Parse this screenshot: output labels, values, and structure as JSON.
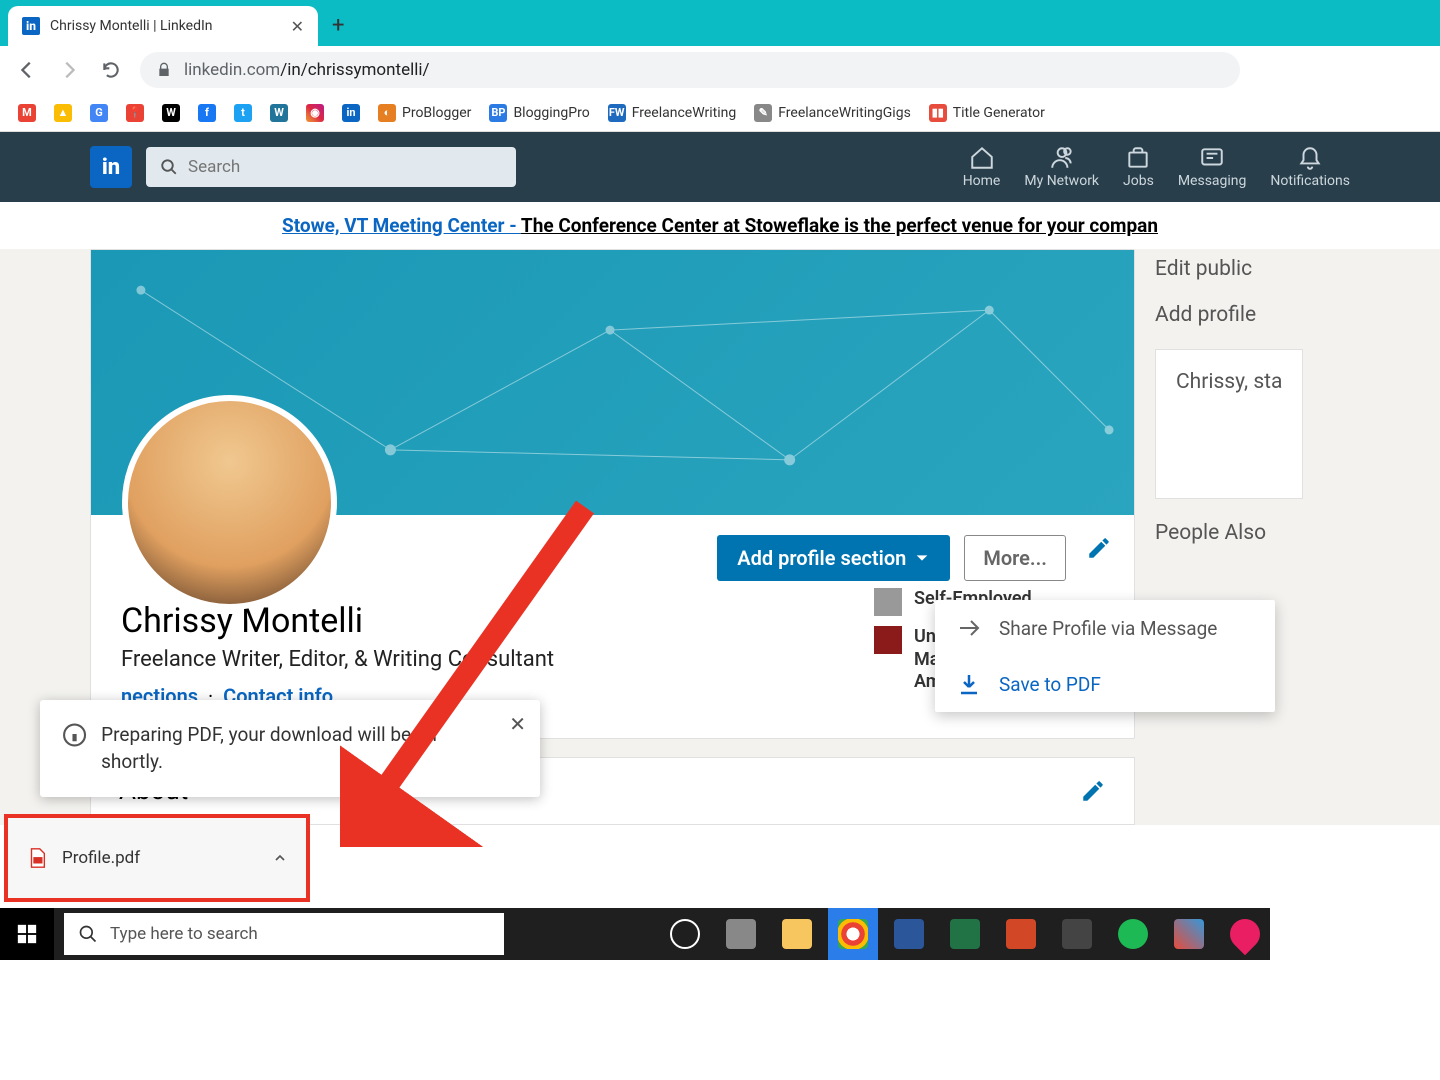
{
  "browser": {
    "tab_title": "Chrissy Montelli | LinkedIn",
    "url_host": "linkedin.com",
    "url_path": "/in/chrissymontelli/"
  },
  "bookmarks": [
    {
      "label": "",
      "icon": "M",
      "bg": "#ea4335"
    },
    {
      "label": "",
      "icon": "▲",
      "bg": "#fbbc04"
    },
    {
      "label": "",
      "icon": "G",
      "bg": "#4285f4"
    },
    {
      "label": "",
      "icon": "📍",
      "bg": "#ea4335"
    },
    {
      "label": "",
      "icon": "W",
      "bg": "#000"
    },
    {
      "label": "",
      "icon": "f",
      "bg": "#1877f2"
    },
    {
      "label": "",
      "icon": "t",
      "bg": "#1da1f2"
    },
    {
      "label": "",
      "icon": "W",
      "bg": "#21759b"
    },
    {
      "label": "",
      "icon": "◉",
      "bg": "linear-gradient(45deg,#f09433,#e6683c,#dc2743,#cc2366,#bc1888)"
    },
    {
      "label": "",
      "icon": "in",
      "bg": "#0a66c2"
    },
    {
      "label": "ProBlogger",
      "icon": "◐",
      "bg": "#e67e22"
    },
    {
      "label": "BloggingPro",
      "icon": "BP",
      "bg": "#2c7be5"
    },
    {
      "label": "FreelanceWriting",
      "icon": "FW",
      "bg": "#1e6abf"
    },
    {
      "label": "FreelanceWritingGigs",
      "icon": "✎",
      "bg": "#888"
    },
    {
      "label": "Title Generator",
      "icon": "▮▮",
      "bg": "#e74c3c"
    }
  ],
  "linkedin_nav": {
    "search_placeholder": "Search",
    "items": [
      {
        "label": "Home"
      },
      {
        "label": "My Network"
      },
      {
        "label": "Jobs"
      },
      {
        "label": "Messaging"
      },
      {
        "label": "Notifications"
      }
    ]
  },
  "ad": {
    "link": "Stowe, VT Meeting Center - ",
    "rest": "The Conference Center at Stoweflake is the perfect venue for your compan"
  },
  "profile": {
    "name": "Chrissy Montelli",
    "title": "Freelance Writer, Editor, & Writing Consultant",
    "connections": "nections",
    "dot": "·",
    "contact": "Contact info",
    "add_section": "Add profile section",
    "more": "More...",
    "about": "About",
    "exp": [
      {
        "name": "Self-Employed"
      },
      {
        "name": "University of Massachusetts Amherst"
      }
    ]
  },
  "dropdown": [
    {
      "label": "Share Profile via Message"
    },
    {
      "label": "Save to PDF"
    }
  ],
  "toast": {
    "msg": "Preparing PDF, your download will begin shortly."
  },
  "download": {
    "file": "Profile.pdf"
  },
  "taskbar": {
    "search_placeholder": "Type here to search"
  },
  "rail": {
    "edit": "Edit public",
    "add": "Add profile",
    "prompt": "Chrissy, sta",
    "also": "People Also"
  }
}
